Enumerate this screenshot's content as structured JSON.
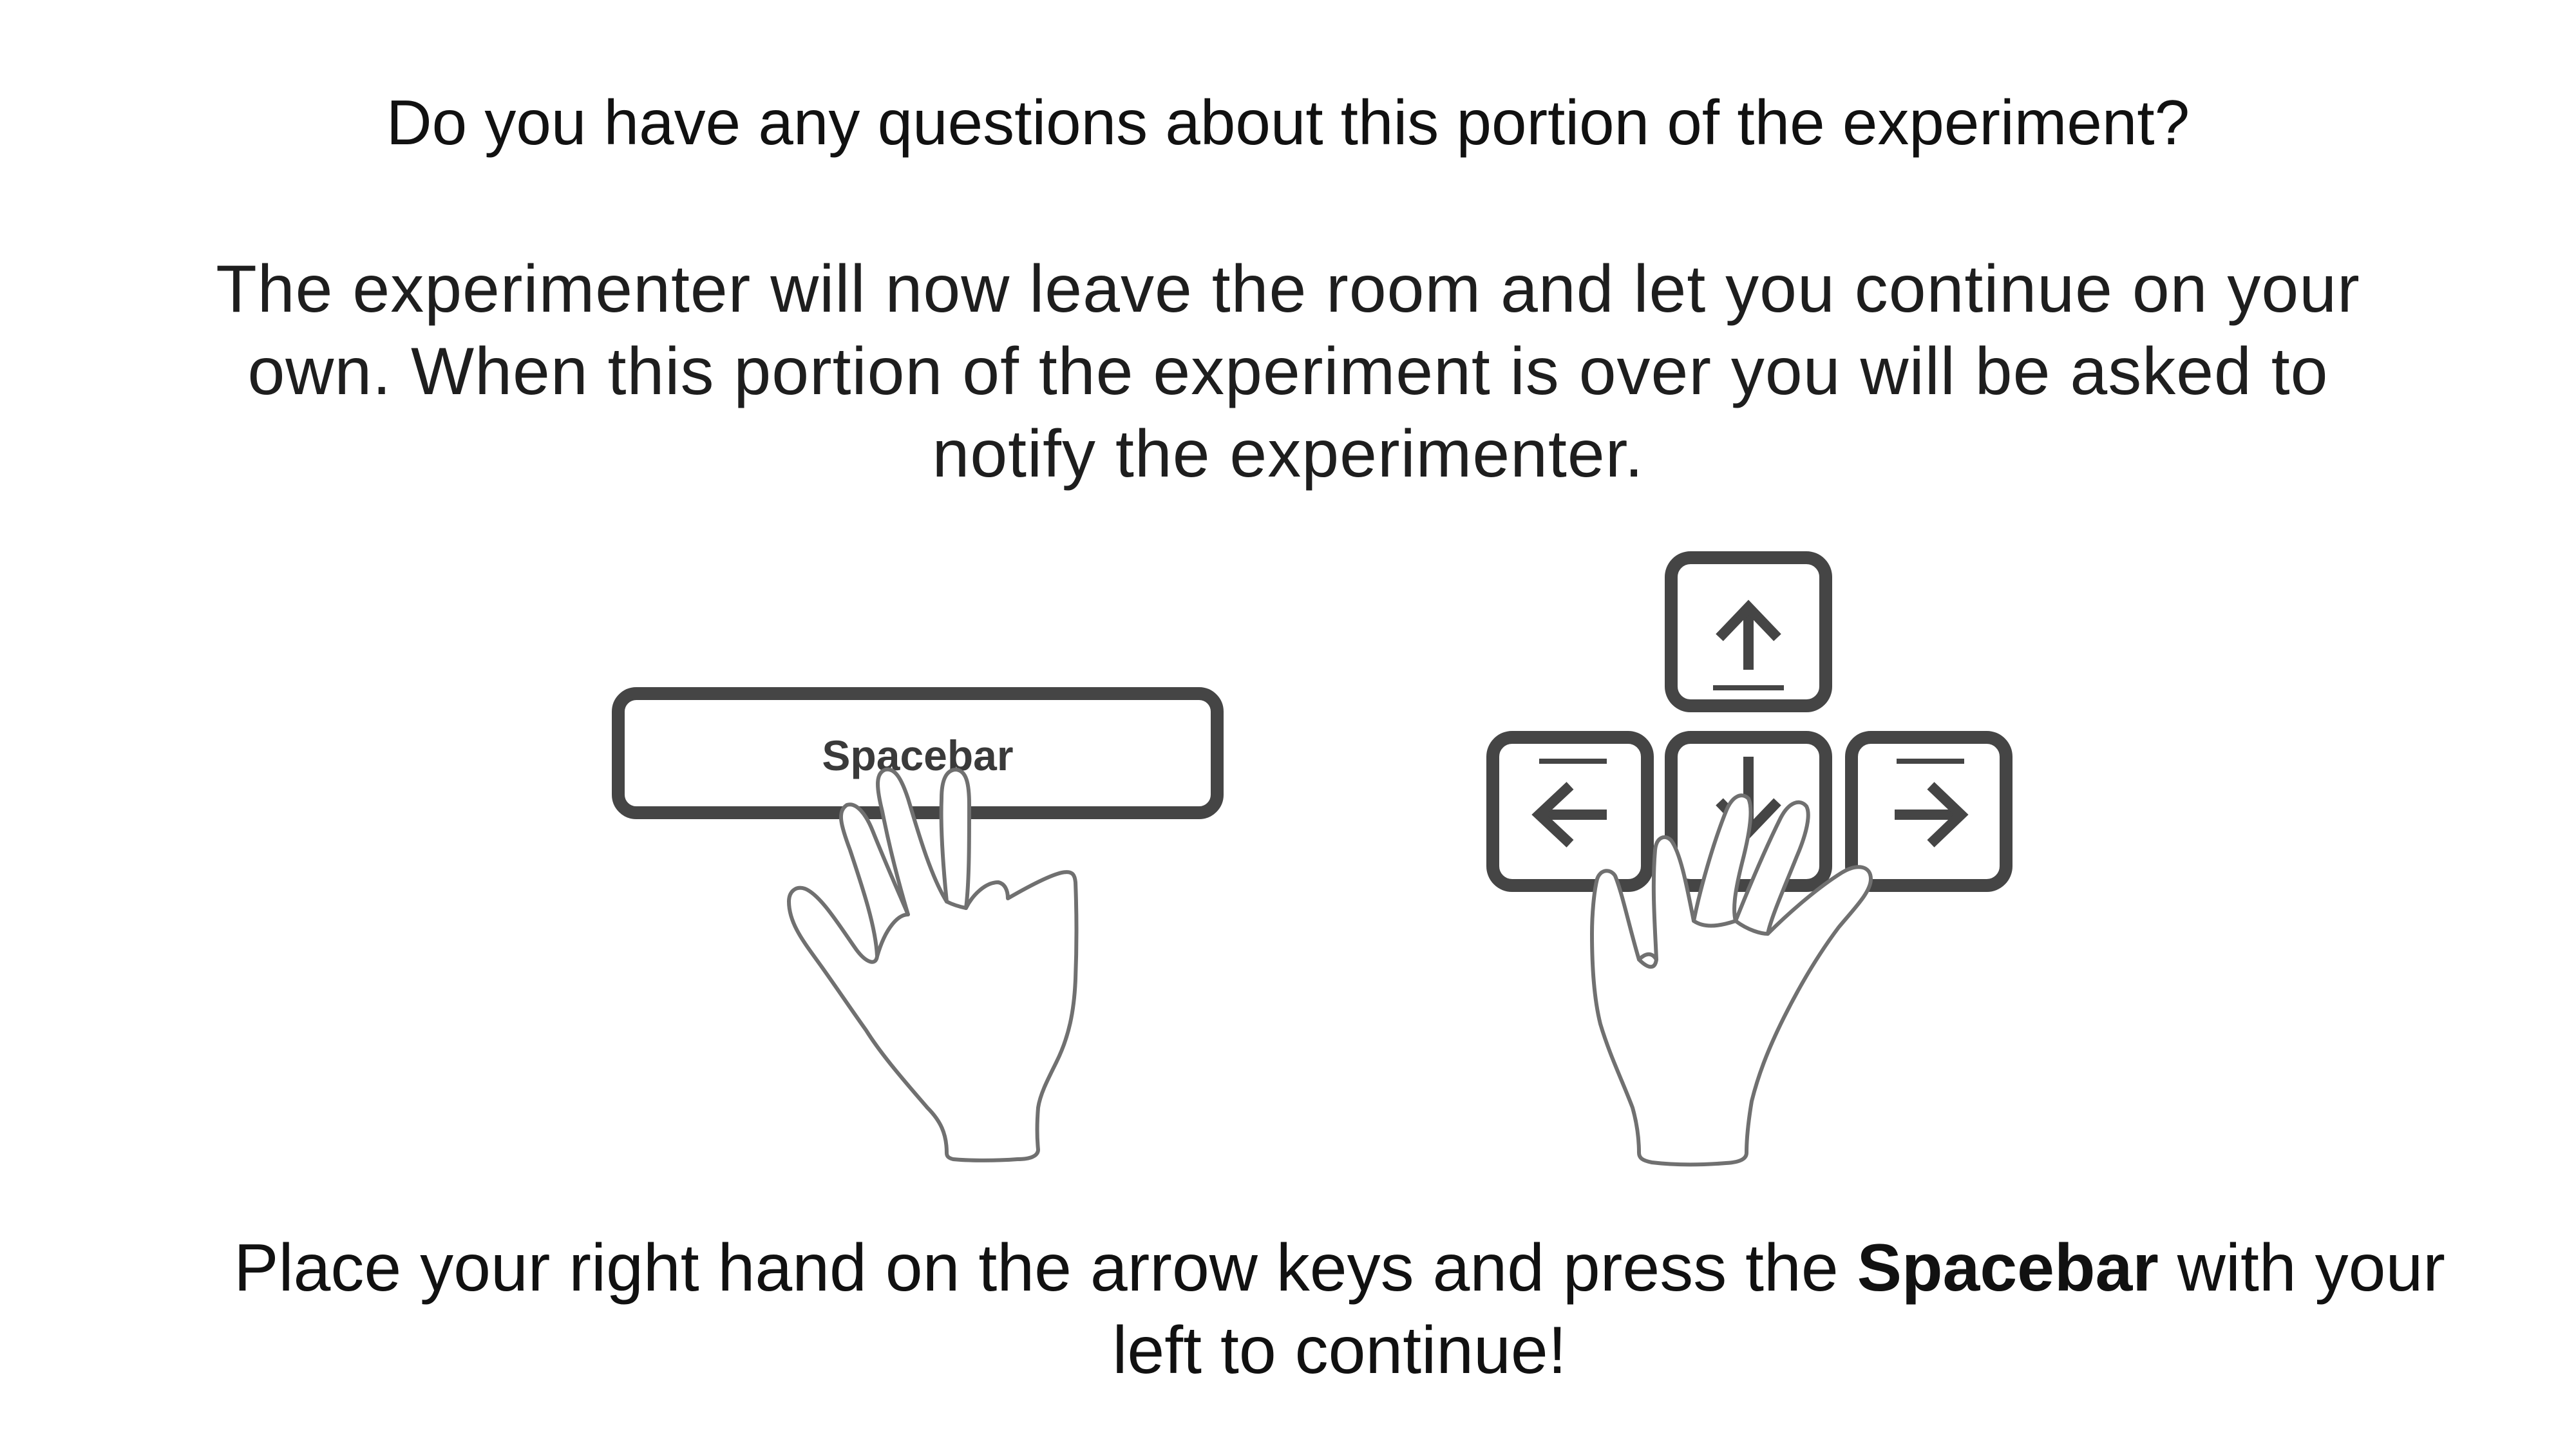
{
  "slide": {
    "question": "Do you have any questions about this portion of the experiment?",
    "info": "The experimenter will now leave the room and let you continue on your own. When this portion of the experiment is over you will be asked to notify the experimenter.",
    "instruction": {
      "before": "Place your right hand on the arrow keys and press the ",
      "bold": "Spacebar",
      "after": " with your left to continue!"
    }
  },
  "spacebar_illustration": {
    "key_label": "Spacebar",
    "hand": "left-hand-icon"
  },
  "arrow_keys_illustration": {
    "keys": [
      "up-arrow-icon",
      "left-arrow-icon",
      "down-arrow-icon",
      "right-arrow-icon"
    ],
    "hand": "right-hand-icon"
  },
  "colors": {
    "text": "#111111",
    "key_outline": "#454545",
    "hand_outline": "#707070",
    "background": "#ffffff"
  }
}
